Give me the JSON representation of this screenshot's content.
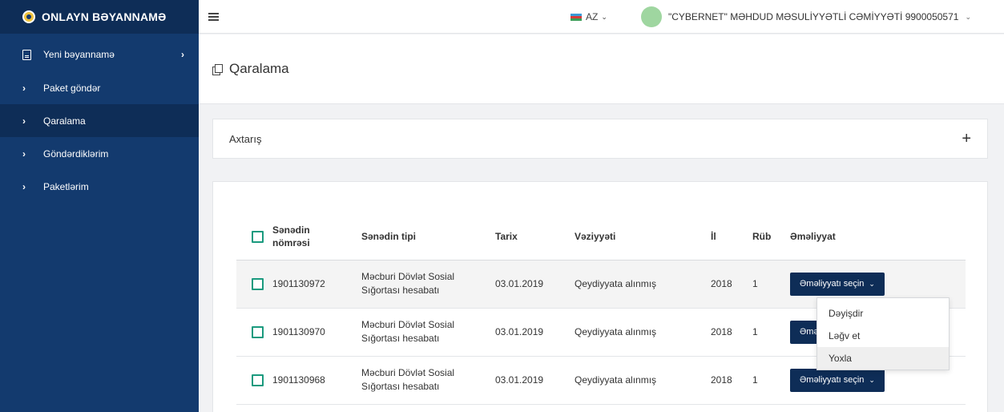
{
  "brand": {
    "title": "ONLAYN BƏYANNAMƏ"
  },
  "sidebar": {
    "items": [
      {
        "label": "Yeni bəyannamə"
      },
      {
        "label": "Paket göndər"
      },
      {
        "label": "Qaralama"
      },
      {
        "label": "Göndərdiklərim"
      },
      {
        "label": "Paketlərim"
      }
    ]
  },
  "topbar": {
    "language": "AZ",
    "user": "\"CYBERNET\" MƏHDUD MƏSULİYYƏTLİ CƏMİYYƏTİ 9900050571"
  },
  "page": {
    "title": "Qaralama"
  },
  "search": {
    "title": "Axtarış",
    "expand_glyph": "+"
  },
  "table": {
    "headers": [
      "Sənədin nömrəsi",
      "Sənədin tipi",
      "Tarix",
      "Vəziyyəti",
      "İl",
      "Rüb",
      "Əməliyyat"
    ],
    "rows": [
      {
        "number": "1901130972",
        "type": "Məcburi Dövlət Sosial Sığortası hesabatı",
        "date": "03.01.2019",
        "status": "Qeydiyyata alınmış",
        "year": "2018",
        "quarter": "1",
        "action": "Əməliyyatı seçin"
      },
      {
        "number": "1901130970",
        "type": "Məcburi Dövlət Sosial Sığortası hesabatı",
        "date": "03.01.2019",
        "status": "Qeydiyyata alınmış",
        "year": "2018",
        "quarter": "1",
        "action": "Əməliyyatı seçin"
      },
      {
        "number": "1901130968",
        "type": "Məcburi Dövlət Sosial Sığortası hesabatı",
        "date": "03.01.2019",
        "status": "Qeydiyyata alınmış",
        "year": "2018",
        "quarter": "1",
        "action": "Əməliyyatı seçin"
      }
    ]
  },
  "dropdown": {
    "items": [
      "Dəyişdir",
      "Ləğv et",
      "Yoxla"
    ]
  },
  "colors": {
    "sidebar_bg": "#133a6e",
    "sidebar_active": "#0e2d57",
    "button_bg": "#0e2d57",
    "checkbox_border": "#1a9a7e",
    "avatar": "#9fd6a0"
  },
  "icons": [
    "shield-logo-icon",
    "document-icon",
    "chevron-right-icon",
    "hamburger-icon",
    "flag-icon",
    "chevron-down-icon",
    "copy-icon",
    "plus-icon",
    "checkbox-icon"
  ]
}
